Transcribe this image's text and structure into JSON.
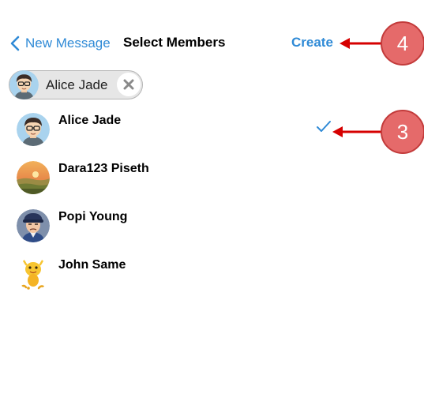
{
  "navbar": {
    "back_label": "New Message",
    "title": "Select Members",
    "create_label": "Create"
  },
  "selected_chips": [
    {
      "name": "Alice Jade",
      "avatar": "boy-avatar-icon"
    }
  ],
  "members": [
    {
      "name": "Alice Jade",
      "avatar": "boy-avatar-icon",
      "selected": true
    },
    {
      "name": "Dara123 Piseth",
      "avatar": "landscape-photo-avatar",
      "selected": false
    },
    {
      "name": "Popi Young",
      "avatar": "man-cap-avatar-icon",
      "selected": false
    },
    {
      "name": "John Same",
      "avatar": "yellow-cartoon-avatar",
      "selected": false
    }
  ],
  "annotations": [
    {
      "number": "4"
    },
    {
      "number": "3"
    }
  ],
  "colors": {
    "accent": "#2f8ad6",
    "annotation_fill": "#e56a6a",
    "annotation_arrow": "#d60000"
  }
}
